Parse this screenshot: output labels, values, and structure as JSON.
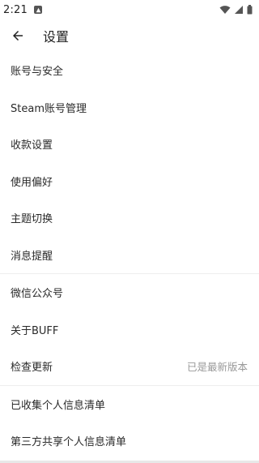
{
  "status_bar": {
    "time": "2:21"
  },
  "app_bar": {
    "title": "设置"
  },
  "settings": {
    "items": [
      {
        "label": "账号与安全"
      },
      {
        "label": "Steam账号管理"
      },
      {
        "label": "收款设置"
      },
      {
        "label": "使用偏好"
      },
      {
        "label": "主题切换"
      },
      {
        "label": "消息提醒"
      },
      {
        "label": "微信公众号"
      },
      {
        "label": "关于BUFF"
      },
      {
        "label": "检查更新",
        "value": "已是最新版本"
      },
      {
        "label": "已收集个人信息清单"
      },
      {
        "label": "第三方共享个人信息清单"
      }
    ]
  },
  "icons": {
    "back": "arrow-left-icon",
    "notification": "app-notification-icon",
    "wifi": "wifi-icon",
    "signal": "cell-signal-icon",
    "battery": "battery-icon"
  },
  "colors": {
    "background": "#ffffff",
    "text": "#222222",
    "secondary_text": "#999999",
    "divider": "#eeeeee"
  }
}
